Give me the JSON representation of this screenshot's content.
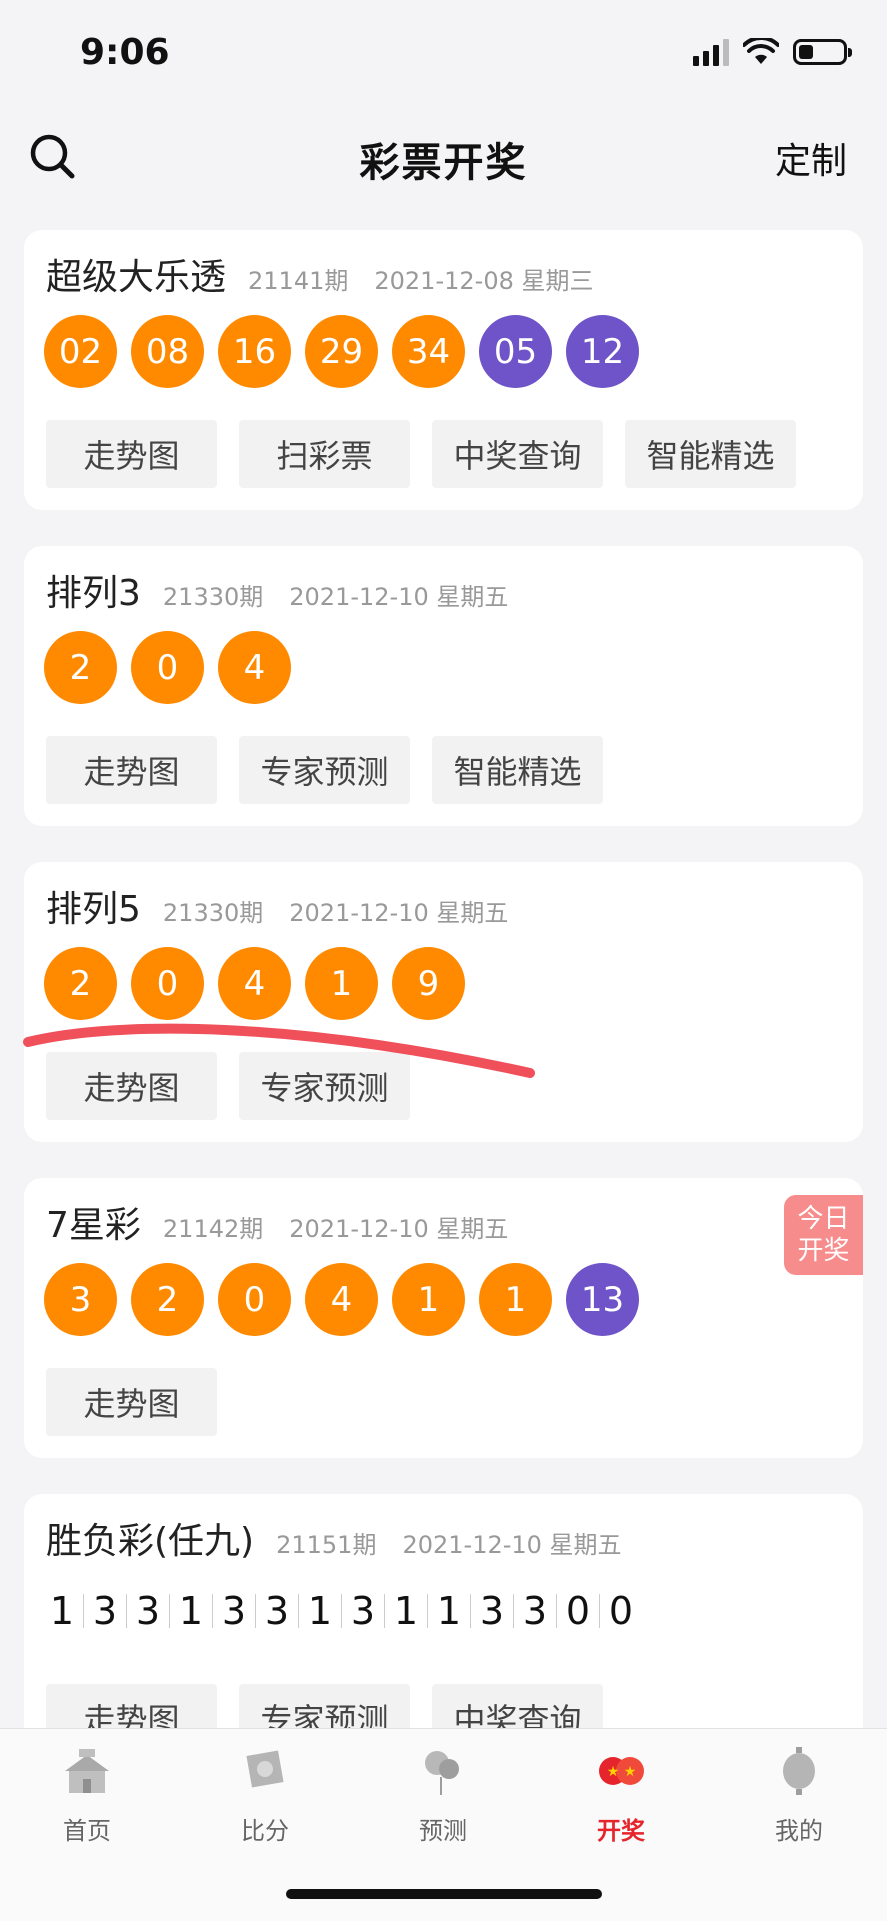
{
  "status": {
    "time": "9:06"
  },
  "nav": {
    "title": "彩票开奖",
    "custom_label": "定制"
  },
  "lotteries": [
    {
      "name": "超级大乐透",
      "issue": "21141期",
      "date": "2021-12-08 星期三",
      "red_balls": [
        "02",
        "08",
        "16",
        "29",
        "34"
      ],
      "blue_balls": [
        "05",
        "12"
      ],
      "buttons": [
        "走势图",
        "扫彩票",
        "中奖查询",
        "智能精选"
      ]
    },
    {
      "name": "排列3",
      "issue": "21330期",
      "date": "2021-12-10 星期五",
      "red_balls": [
        "2",
        "0",
        "4"
      ],
      "blue_balls": [],
      "buttons": [
        "走势图",
        "专家预测",
        "智能精选"
      ]
    },
    {
      "name": "排列5",
      "issue": "21330期",
      "date": "2021-12-10 星期五",
      "red_balls": [
        "2",
        "0",
        "4",
        "1",
        "9"
      ],
      "blue_balls": [],
      "buttons": [
        "走势图",
        "专家预测"
      ]
    },
    {
      "name": "7星彩",
      "issue": "21142期",
      "date": "2021-12-10 星期五",
      "red_balls": [
        "3",
        "2",
        "0",
        "4",
        "1",
        "1"
      ],
      "blue_balls": [
        "13"
      ],
      "buttons": [
        "走势图"
      ],
      "badge": [
        "今日",
        "开奖"
      ]
    },
    {
      "name": "胜负彩(任九)",
      "issue": "21151期",
      "date": "2021-12-10 星期五",
      "results": [
        "1",
        "3",
        "3",
        "1",
        "3",
        "3",
        "1",
        "3",
        "1",
        "1",
        "3",
        "3",
        "0",
        "0"
      ],
      "buttons": [
        "走势图",
        "专家预测",
        "中奖查询"
      ]
    }
  ],
  "tabs": [
    {
      "label": "首页",
      "icon": "home-tower-icon"
    },
    {
      "label": "比分",
      "icon": "score-stamp-icon"
    },
    {
      "label": "预测",
      "icon": "prediction-balloon-icon"
    },
    {
      "label": "开奖",
      "icon": "draw-balls-icon",
      "active": true
    },
    {
      "label": "我的",
      "icon": "profile-lantern-icon"
    }
  ],
  "colors": {
    "red_ball": "#ff8a00",
    "blue_ball": "#6f53c8",
    "active_tab": "#e6242c",
    "badge": "#f78c8c",
    "annotation": "#f0505a"
  }
}
